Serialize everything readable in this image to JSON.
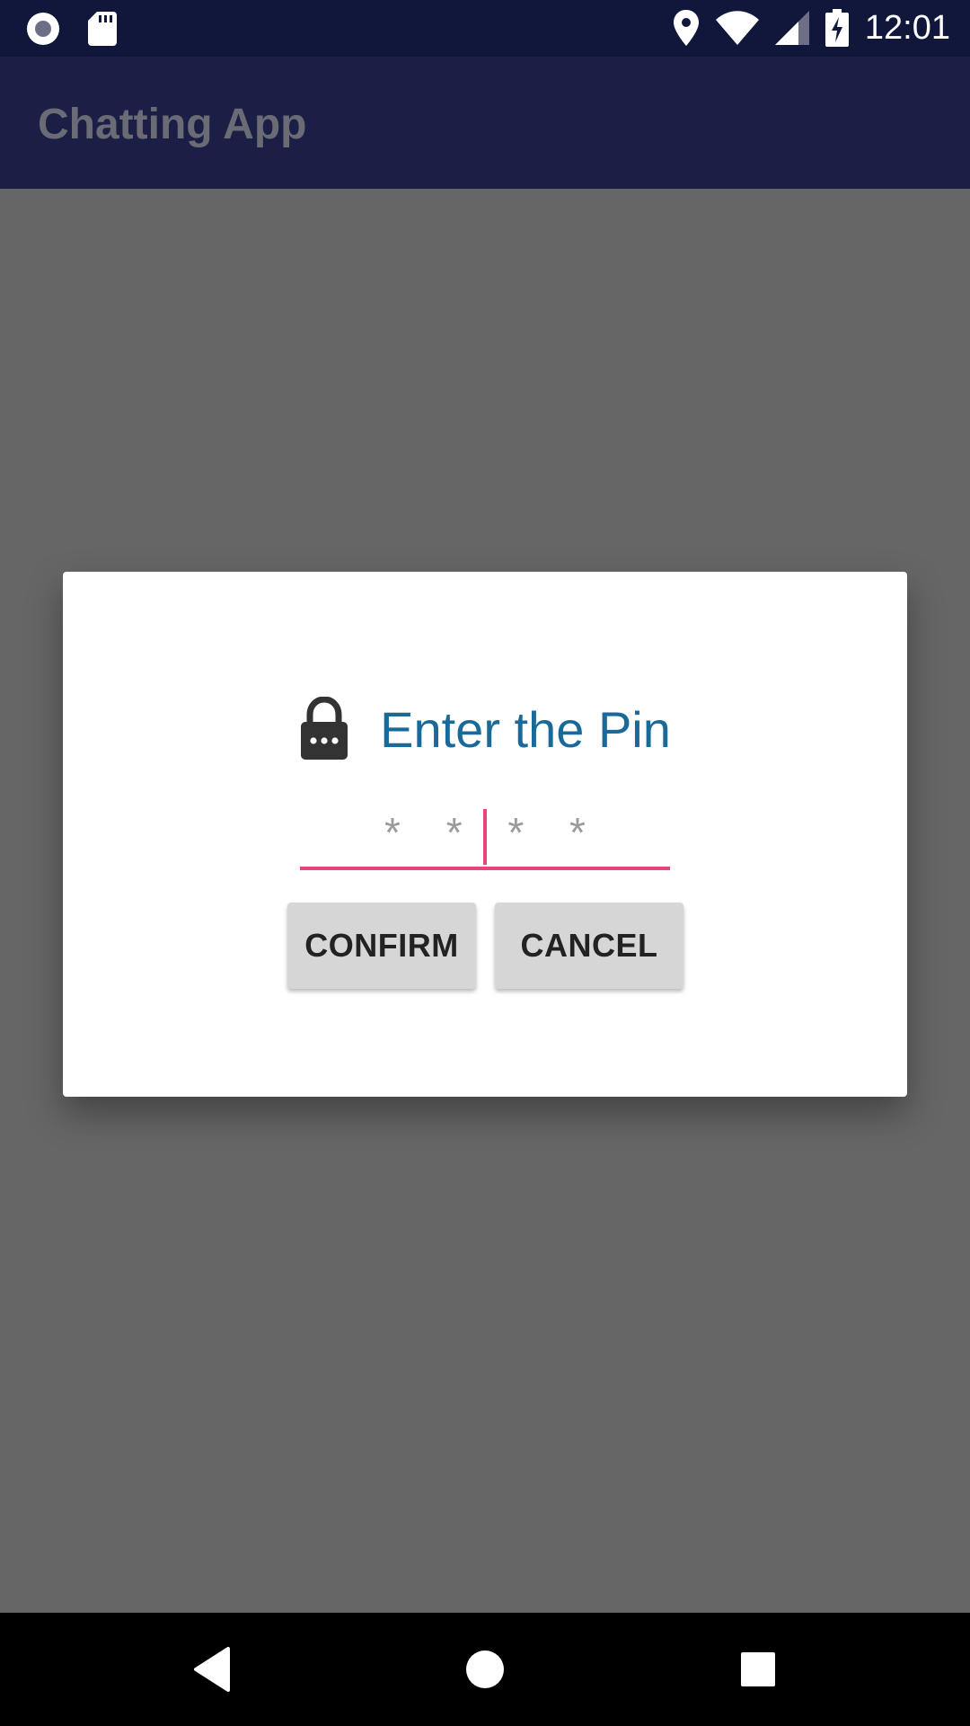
{
  "status_bar": {
    "time": "12:01",
    "icons": [
      "record-icon",
      "sd-card-icon",
      "location-icon",
      "wifi-icon",
      "cell-signal-icon",
      "battery-charging-icon"
    ]
  },
  "app_bar": {
    "title": "Chatting App"
  },
  "dialog": {
    "icon": "lock-icon",
    "title": "Enter the Pin",
    "pin_input": {
      "value": "",
      "placeholder": "* * * *"
    },
    "confirm_label": "CONFIRM",
    "cancel_label": "CANCEL"
  },
  "nav_bar": {
    "buttons": [
      "back-icon",
      "home-icon",
      "recents-icon"
    ]
  },
  "colors": {
    "status_bar": "#11173a",
    "app_bar": "#1b1f45",
    "scrim": "#666666",
    "dialog_title": "#1a6a99",
    "accent": "#e8437a",
    "button": "#d6d6d6"
  }
}
